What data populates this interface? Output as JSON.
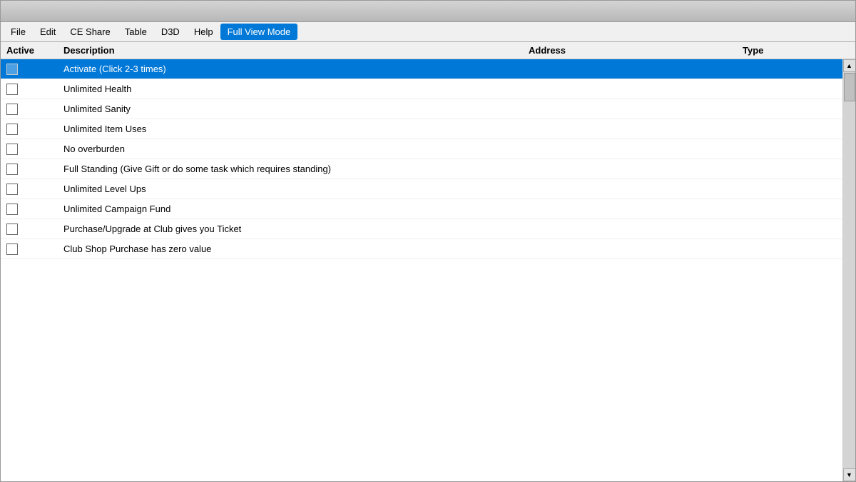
{
  "menu": {
    "items": [
      {
        "label": "File",
        "active": false
      },
      {
        "label": "Edit",
        "active": false
      },
      {
        "label": "CE Share",
        "active": false
      },
      {
        "label": "Table",
        "active": false
      },
      {
        "label": "D3D",
        "active": false
      },
      {
        "label": "Help",
        "active": false
      },
      {
        "label": "Full View Mode",
        "active": true
      }
    ]
  },
  "table": {
    "headers": {
      "active": "Active",
      "description": "Description",
      "address": "Address",
      "type": "Type"
    },
    "rows": [
      {
        "id": "activate-row",
        "selected": true,
        "checked": false,
        "description": "Activate (Click 2-3 times)",
        "address": "",
        "type": ""
      },
      {
        "id": "unlimited-health",
        "selected": false,
        "checked": false,
        "description": "Unlimited Health",
        "address": "",
        "type": ""
      },
      {
        "id": "unlimited-sanity",
        "selected": false,
        "checked": false,
        "description": "Unlimited Sanity",
        "address": "",
        "type": ""
      },
      {
        "id": "unlimited-item-uses",
        "selected": false,
        "checked": false,
        "description": "Unlimited Item Uses",
        "address": "",
        "type": ""
      },
      {
        "id": "no-overburden",
        "selected": false,
        "checked": false,
        "description": "No overburden",
        "address": "",
        "type": ""
      },
      {
        "id": "full-standing",
        "selected": false,
        "checked": false,
        "description": "Full Standing (Give Gift or do some task which requires standing)",
        "address": "",
        "type": ""
      },
      {
        "id": "unlimited-level-ups",
        "selected": false,
        "checked": false,
        "description": "Unlimited Level Ups",
        "address": "",
        "type": ""
      },
      {
        "id": "unlimited-campaign-fund",
        "selected": false,
        "checked": false,
        "description": "Unlimited Campaign Fund",
        "address": "",
        "type": ""
      },
      {
        "id": "purchase-upgrade-ticket",
        "selected": false,
        "checked": false,
        "description": "Purchase/Upgrade at Club gives you Ticket",
        "address": "",
        "type": ""
      },
      {
        "id": "club-shop-purchase",
        "selected": false,
        "checked": false,
        "description": "Club Shop Purchase has zero value",
        "address": "",
        "type": ""
      }
    ]
  },
  "colors": {
    "selected_bg": "#0078d7",
    "selected_text": "#ffffff",
    "header_bg": "#f0f0f0"
  }
}
